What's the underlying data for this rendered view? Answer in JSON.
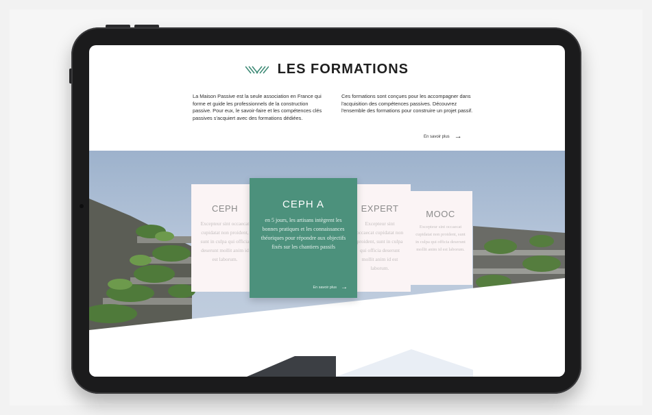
{
  "section": {
    "title": "LES FORMATIONS",
    "intro_left": "La Maison Passive est la seule association en France qui forme et guide les professionnels de la construction passive. Pour eux, le savoir-faire et les compétences clés passives s'acquiert avec des formations dédiées.",
    "intro_right": "Ces formations sont conçues pour les accompagner dans l'acquisition des compétences passives. Découvrez l'ensemble des formations pour construire un projet passif.",
    "more_label": "En savoir plus"
  },
  "cards": [
    {
      "title": "CEPH",
      "text": "Excepteur sint occaecat cupidatat non proident, sunt in culpa qui officia deserunt mollit anim id est laborum."
    },
    {
      "title": "CEPH A",
      "text": "en 5 jours, les artisans intègrent les bonnes pratiques et les connaissances théoriques pour répondre aux objectifs fixés sur les chantiers passifs",
      "more_label": "En savoir plus"
    },
    {
      "title": "EXPERT",
      "text": "Excepteur sint occaecat cupidatat non proident, sunt in culpa qui officia deserunt mollit anim id est laborum."
    },
    {
      "title": "MOOC",
      "text": "Excepteur sint occaecat cupidatat non proident, sunt in culpa qui officia deserunt mollit anim id est laborum."
    }
  ],
  "icons": {
    "title_deco": "diagonal-stripes-icon",
    "arrow_right": "arrow-right-icon",
    "arrow_down": "arrow-down-icon"
  },
  "colors": {
    "accent": "#4c917c",
    "card_bg": "#fbf4f5"
  }
}
